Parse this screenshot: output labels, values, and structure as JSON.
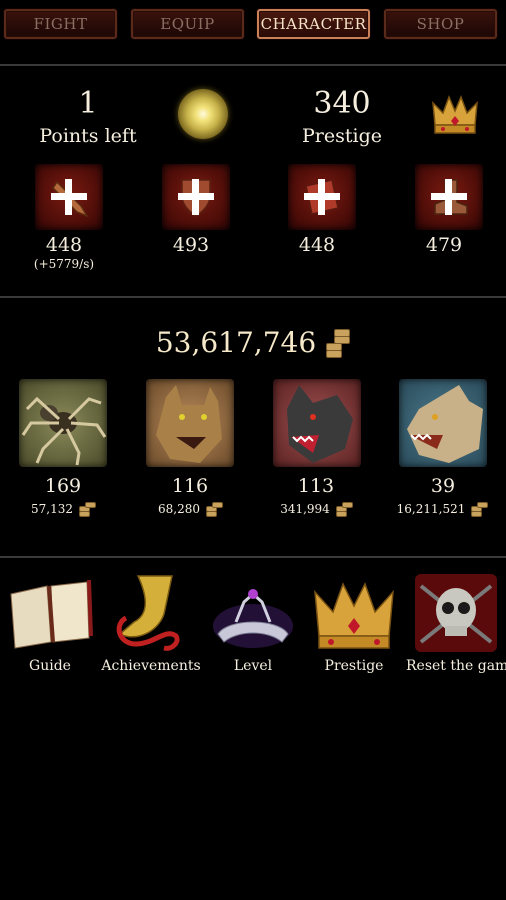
{
  "tabs": [
    {
      "label": "FIGHT",
      "active": false
    },
    {
      "label": "EQUIP",
      "active": false
    },
    {
      "label": "CHARACTER",
      "active": true
    },
    {
      "label": "SHOP",
      "active": false
    }
  ],
  "points": {
    "value": "1",
    "label": "Points left"
  },
  "prestige": {
    "value": "340",
    "label": "Prestige"
  },
  "attributes": [
    {
      "value": "448",
      "sub": "(+5779/s)",
      "icon": "club-icon"
    },
    {
      "value": "493",
      "sub": "",
      "icon": "shield-icon"
    },
    {
      "value": "448",
      "sub": "",
      "icon": "book-icon"
    },
    {
      "value": "479",
      "sub": "",
      "icon": "boot-icon"
    }
  ],
  "gold": {
    "value": "53,617,746"
  },
  "monsters": [
    {
      "name": "spider",
      "count": "169",
      "cost": "57,132",
      "bg": "#6b6a3c"
    },
    {
      "name": "lynx",
      "count": "116",
      "cost": "68,280",
      "bg": "#8a5a3a"
    },
    {
      "name": "wolf",
      "count": "113",
      "cost": "341,994",
      "bg": "#8a3a3a"
    },
    {
      "name": "dragon",
      "count": "39",
      "cost": "16,211,521",
      "bg": "#3a5a6a"
    }
  ],
  "menu": [
    {
      "label": "Guide",
      "icon": "book-icon"
    },
    {
      "label": "Achievements",
      "icon": "horn-icon"
    },
    {
      "label": "Level",
      "icon": "tiara-icon"
    },
    {
      "label": "Prestige",
      "icon": "crown-icon"
    },
    {
      "label": "Reset the game",
      "icon": "skull-icon"
    }
  ],
  "colors": {
    "background": "#000000",
    "tab_border_active": "#c9815a",
    "button_red": "#7a1a10",
    "text": "#f6efe0"
  }
}
